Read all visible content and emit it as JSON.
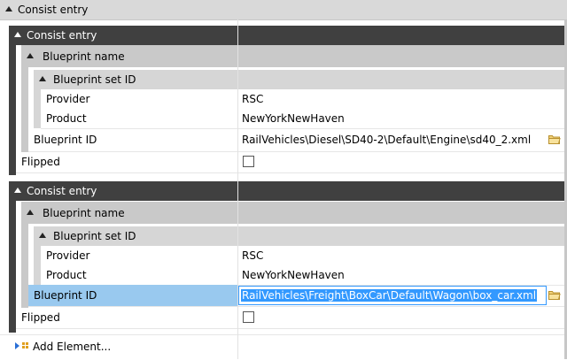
{
  "root": {
    "title": "Consist entry"
  },
  "consist_entries": [
    {
      "header": "Consist entry",
      "blueprint_name_label": "Blueprint name",
      "blueprint_set_id_label": "Blueprint set ID",
      "provider_label": "Provider",
      "provider_value": "RSC",
      "product_label": "Product",
      "product_value": "NewYorkNewHaven",
      "blueprint_id_label": "Blueprint ID",
      "blueprint_id_value": "RailVehicles\\Diesel\\SD40-2\\Default\\Engine\\sd40_2.xml",
      "flipped_label": "Flipped",
      "flipped_checked": false
    },
    {
      "header": "Consist entry",
      "blueprint_name_label": "Blueprint name",
      "blueprint_set_id_label": "Blueprint set ID",
      "provider_label": "Provider",
      "provider_value": "RSC",
      "product_label": "Product",
      "product_value": "NewYorkNewHaven",
      "blueprint_id_label": "Blueprint ID",
      "blueprint_id_value": "RailVehicles\\Freight\\BoxCar\\Default\\Wagon\\box_car.xml",
      "flipped_label": "Flipped",
      "flipped_checked": false
    }
  ],
  "add_element_label": "Add Element...",
  "icons": {
    "expand": "collapse-triangle-icon",
    "browse": "folder-icon",
    "add": "add-element-icon"
  },
  "colors": {
    "dark_header": "#404040",
    "selection": "#99c9ef",
    "edit_highlight": "#3399ff"
  }
}
